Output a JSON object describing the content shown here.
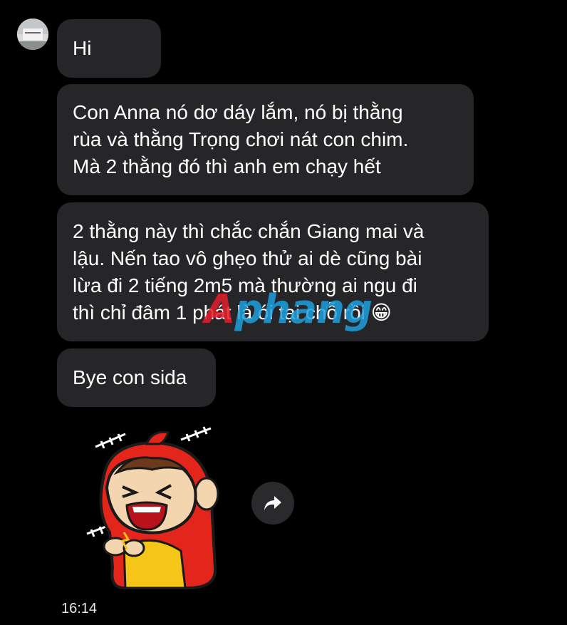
{
  "conversation": {
    "messages": [
      {
        "text": "Hi"
      },
      {
        "text": "Con Anna nó dơ dáy lắm, nó bị thằng\nrùa và thằng Trọng chơi nát con chim.\nMà 2 thằng đó thì anh em chạy hết"
      },
      {
        "text": "2 thằng này thì chắc chắn Giang mai và\nlậu. Nến tao vô ghẹo thử ai dè cũng bài\nlừa đi 2 tiếng 2m5 mà thường ai ngu đi\nthì chỉ đâm 1 phát là ói tại chỗ rồi 😁"
      },
      {
        "text": "Bye con sida"
      }
    ],
    "sticker": {
      "name": "red-monkey-laughing-sticker"
    },
    "forward_icon": "forward-arrow-icon",
    "timestamp": "16:14"
  },
  "watermark": {
    "first": "A",
    "rest": "phang"
  },
  "colors": {
    "background": "#000000",
    "bubble": "#262628",
    "text": "#ffffff",
    "watermark_red": "#e41d2a",
    "watermark_blue": "#1ea0dc"
  }
}
